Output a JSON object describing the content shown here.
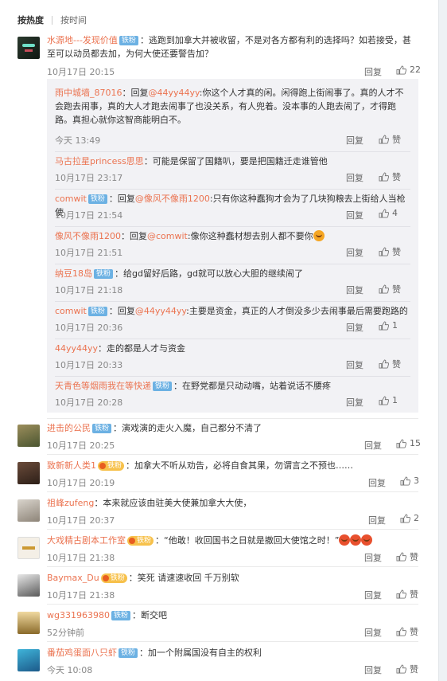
{
  "sort": {
    "hot": "按热度",
    "time": "按时间"
  },
  "labels": {
    "reply": "回复",
    "like": "赞"
  },
  "colors": {
    "username": "#eb7350",
    "fan_badge": "#6cb1e3",
    "vip_badge": "#f7c14b"
  },
  "comments": [
    {
      "user": "水源地---发现价值",
      "badge": "铁粉",
      "text": "：逃跑到加拿大并被收留，不是对各方都有利的选择吗？如若接受，甚至可以动员都去加，为何大使还要警告加？",
      "time": "10月17日 20:15",
      "likes": "22",
      "avatar": "dark-avatar-icon"
    },
    {
      "user": "进击的公民",
      "badge": "铁粉",
      "text": "：演戏演的走火入魔，自己都分不清了",
      "time": "10月17日 20:25",
      "likes": "15"
    },
    {
      "user": "致新新人类1",
      "badge": "铁粉",
      "text": "：加拿大不听从劝告，必将自食其果，勿谓言之不预也……",
      "time": "10月17日 20:19",
      "likes": "3"
    },
    {
      "user": "祖峰zufeng",
      "text": "：本来就应该由驻美大使兼加拿大大使，",
      "time": "10月17日 20:37",
      "likes": "2"
    },
    {
      "user": "大戏精古剧本工作室",
      "badge": "铁粉",
      "text": "：“他敢！收回国书之日就是撤回大使馆之时！”",
      "time": "10月17日 21:38",
      "likes": "赞"
    },
    {
      "user": "Baymax_Du",
      "badge": "铁粉",
      "text": "：笑死 请速速收回 千万别软",
      "time": "10月17日 21:38",
      "likes": "赞"
    },
    {
      "user": "wg331963980",
      "badge": "铁粉",
      "text": "：断交吧",
      "time": "52分钟前",
      "likes": "赞"
    },
    {
      "user": "番茄鸡蛋面八只虾",
      "badge": "铁粉",
      "text": "：加一个附属国没有自主的权利",
      "time": "今天 10:08",
      "likes": "赞"
    }
  ],
  "replies": [
    {
      "user": "雨中城墙_87016",
      "pre": "：回复",
      "at": "@44yy44yy",
      "text": ":你这个人才真的闲。闲得跑上街闹事了。真的人才不会跑去闹事，真的大人才跑去闹事了也没关系，有人兜着。没本事的人跑去闹了，才得跑路。真担心就你这智商能明白不。",
      "time": "今天 13:49",
      "likes": "赞"
    },
    {
      "user": "马古拉星princess思思",
      "text": "：可能是保留了国籍叭，要是把国籍迁走谁管他",
      "time": "10月17日 23:17",
      "likes": "赞"
    },
    {
      "user": "comwit",
      "badge": "铁粉",
      "pre": "：回复",
      "at": "@像风不像雨1200",
      "text": ":只有你这种蠢狗才会为了几块狗粮去上街给人当枪使",
      "time": "10月17日 21:54",
      "likes": "4"
    },
    {
      "user": "像风不像雨1200",
      "pre": "：回复",
      "at": "@comwit",
      "text": ":像你这种蠢材想去别人都不要你",
      "time": "10月17日 21:51",
      "likes": "赞"
    },
    {
      "user": "纳豆18岛",
      "badge": "铁粉",
      "text": "：给gd留好后路，gd就可以放心大胆的继续闹了",
      "time": "10月17日 21:18",
      "likes": "赞"
    },
    {
      "user": "comwit",
      "badge": "铁粉",
      "pre": "：回复",
      "at": "@44yy44yy",
      "text": ":主要是资金，真正的人才倒没多少去闹事最后需要跑路的",
      "time": "10月17日 20:36",
      "likes": "1"
    },
    {
      "user": "44yy44yy",
      "text": "：走的都是人才与资金",
      "time": "10月17日 20:33",
      "likes": "赞"
    },
    {
      "user": "天青色等烟雨我在等快递",
      "badge": "铁粉",
      "text": "：在野党都是只动动嘴，站着说话不腰疼",
      "time": "10月17日 20:28",
      "likes": "1"
    }
  ]
}
